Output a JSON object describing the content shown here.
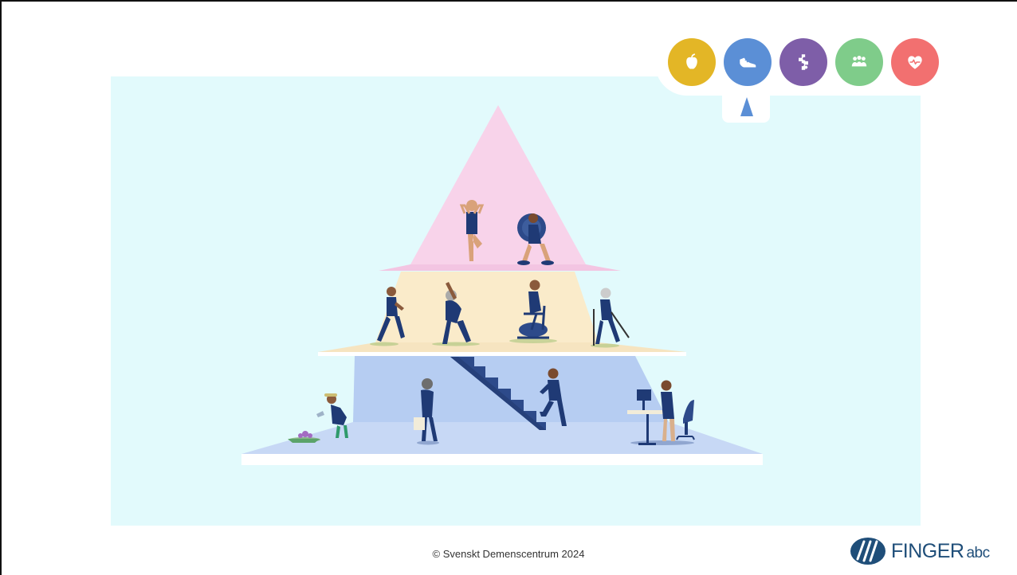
{
  "categories": [
    {
      "id": "nutrition",
      "icon": "apple-icon",
      "color": "#e3b626",
      "active": false
    },
    {
      "id": "physical-activity",
      "icon": "sneaker-icon",
      "color": "#5b8fd6",
      "active": true
    },
    {
      "id": "cognitive-training",
      "icon": "puzzle-piece-icon",
      "color": "#7e5ea8",
      "active": false
    },
    {
      "id": "social-activity",
      "icon": "group-icon",
      "color": "#7fcc8a",
      "active": false
    },
    {
      "id": "heart-health",
      "icon": "heart-pulse-icon",
      "color": "#f27070",
      "active": false
    }
  ],
  "pyramid": {
    "levels": [
      {
        "id": "top",
        "color": "#f8d3ea",
        "figures": [
          "tree-pose-figure",
          "weightlifting-figure"
        ]
      },
      {
        "id": "middle",
        "color": "#faebca",
        "figures": [
          "running-figure",
          "stretching-figure",
          "cycling-figure",
          "nordic-walking-figure"
        ]
      },
      {
        "id": "base",
        "color": "#b3cbf2",
        "figures": [
          "gardening-figure",
          "shopping-figure",
          "stair-climbing-figure",
          "standing-desk-figure"
        ]
      }
    ]
  },
  "footer": {
    "copyright": "© Svenskt Demenscentrum 2024"
  },
  "logo": {
    "name": "FINGER",
    "suffix": "abc",
    "color": "#1f4e79"
  }
}
